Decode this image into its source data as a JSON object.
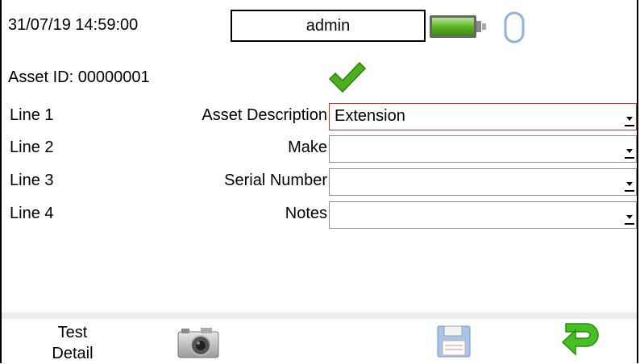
{
  "header": {
    "datetime": "31/07/19 14:59:00",
    "user": "admin"
  },
  "asset": {
    "id_label": "Asset ID: 00000001"
  },
  "lines": [
    {
      "line_label": "Line 1",
      "field_label": "Asset Description",
      "value": "Extension"
    },
    {
      "line_label": "Line 2",
      "field_label": "Make",
      "value": ""
    },
    {
      "line_label": "Line 3",
      "field_label": "Serial Number",
      "value": ""
    },
    {
      "line_label": "Line 4",
      "field_label": "Notes",
      "value": ""
    }
  ],
  "toolbar": {
    "test_detail_line1": "Test",
    "test_detail_line2": "Detail"
  },
  "icons": {
    "battery": "battery-icon",
    "link": "link-icon",
    "status": "checkmark-icon",
    "camera": "camera-icon",
    "save": "save-icon",
    "back": "back-arrow-icon"
  },
  "colors": {
    "battery_green": "#5fb526",
    "check_green": "#4caf1e",
    "active_border": "#c0392b",
    "back_green": "#3fbf1f",
    "save_blue": "#7fa8d8"
  }
}
